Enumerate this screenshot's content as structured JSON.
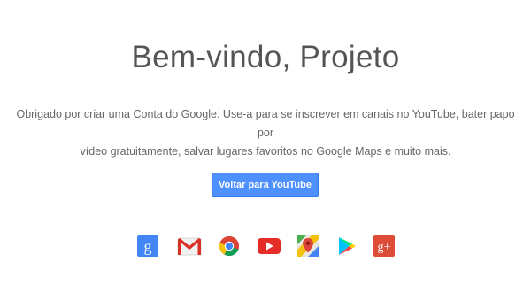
{
  "welcome": {
    "title": "Bem-vindo, Projeto",
    "description_line1": "Obrigado por criar uma Conta do Google. Use-a para se inscrever em canais no YouTube, bater papo por",
    "description_line2": "vídeo gratuitamente, salvar lugares favoritos no Google Maps e muito mais.",
    "button_label": "Voltar para YouTube"
  },
  "products": [
    {
      "name": "google-search-icon",
      "glyph": "g",
      "color": "#4285f4"
    },
    {
      "name": "gmail-icon",
      "color": "#d93025"
    },
    {
      "name": "chrome-icon",
      "color": "#34a853"
    },
    {
      "name": "youtube-icon",
      "color": "#e52d27"
    },
    {
      "name": "google-maps-icon",
      "color": "#4caf50"
    },
    {
      "name": "google-play-icon",
      "color": "#00c4ff"
    },
    {
      "name": "google-plus-icon",
      "glyph": "g+",
      "color": "#dd4b39"
    }
  ],
  "colors": {
    "accent": "#4d90fe",
    "title_text": "#555555",
    "body_text": "#666666"
  }
}
